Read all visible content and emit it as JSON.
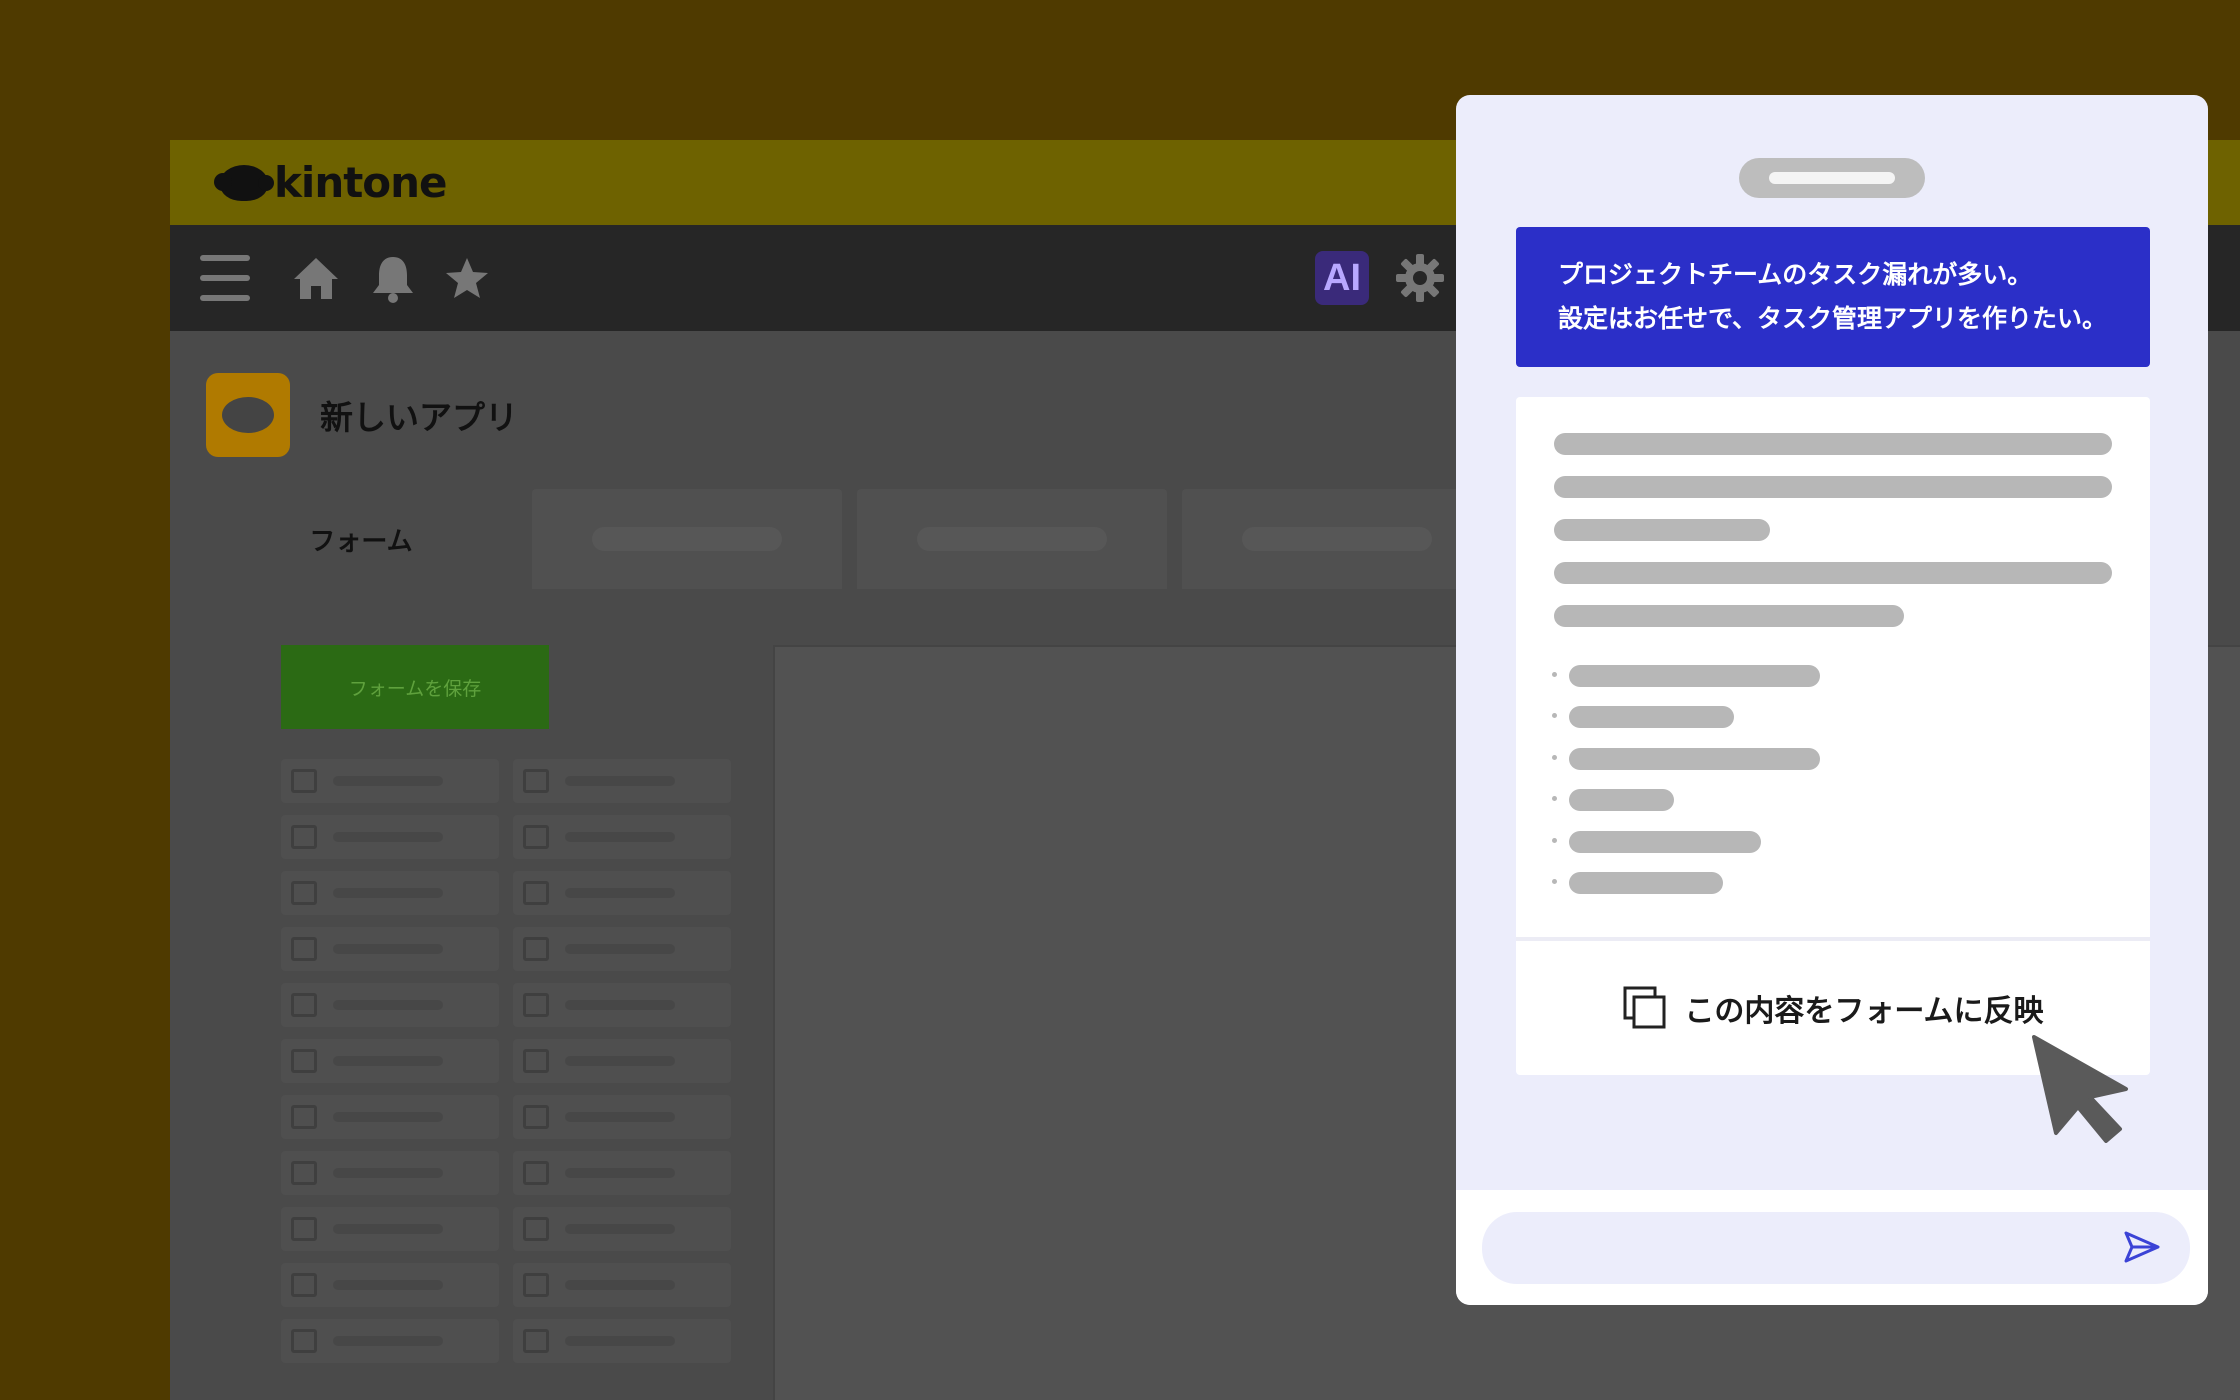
{
  "brand": {
    "name": "kintone"
  },
  "navbar": {
    "ai_label": "AI"
  },
  "app": {
    "title": "新しいアプリ"
  },
  "tabs": [
    {
      "label": "フォーム"
    }
  ],
  "form": {
    "save_label": "フォームを保存"
  },
  "ai_panel": {
    "prompt_lines": [
      "プロジェクトチームのタスク漏れが多い。",
      "設定はお任せで、タスク管理アプリを作りたい。"
    ],
    "reflect_label": "この内容をフォームに反映",
    "input_placeholder": ""
  },
  "colors": {
    "background": "#4f3a00",
    "prompt_bubble": "#2b2fc8",
    "panel_bg": "#ecedfb",
    "send_icon": "#3b43d6"
  },
  "icons": [
    "menu-icon",
    "home-icon",
    "bell-icon",
    "star-icon",
    "gear-icon",
    "copy-icon",
    "cursor-icon",
    "send-icon"
  ]
}
